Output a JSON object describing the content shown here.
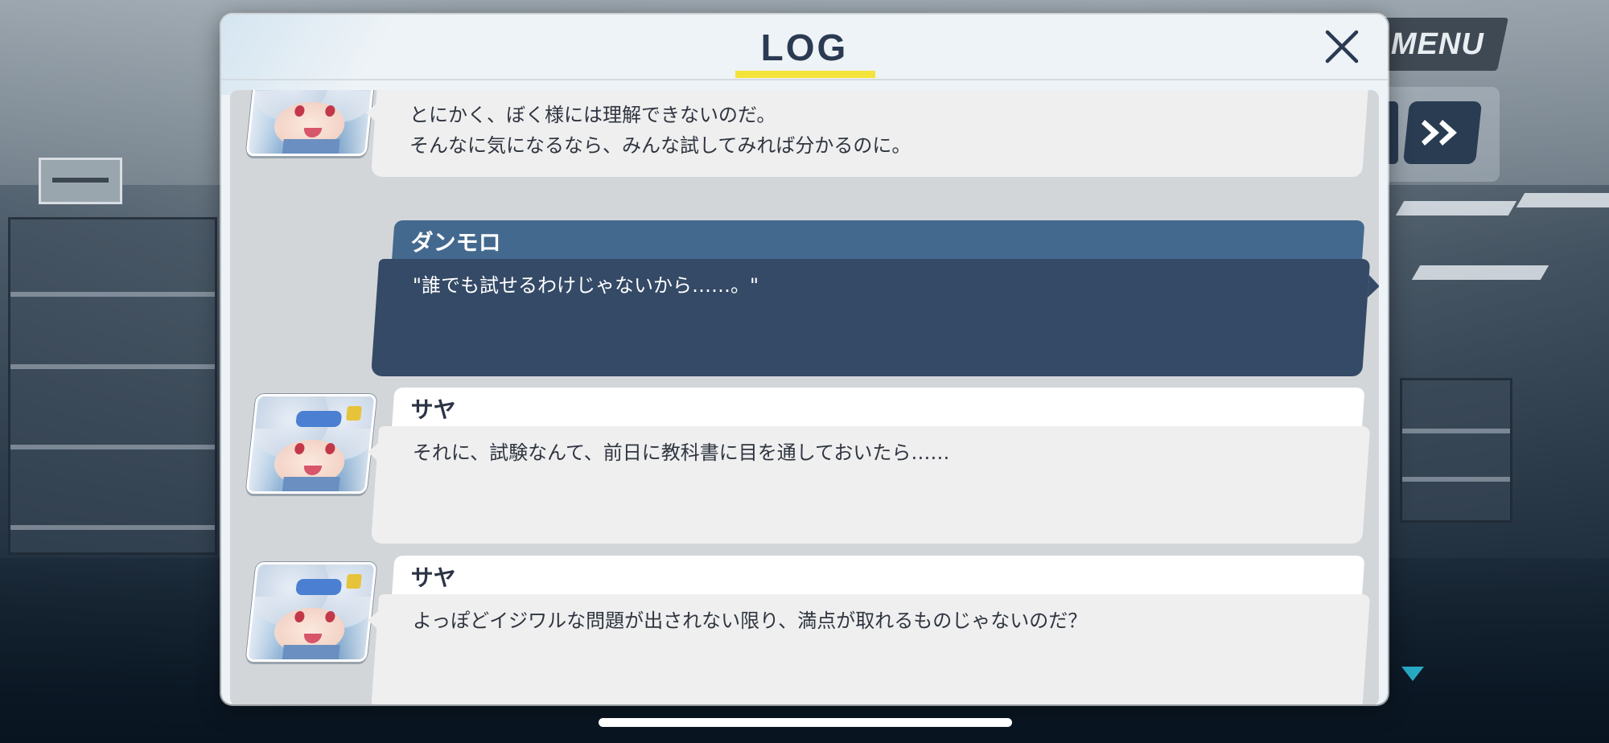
{
  "hud": {
    "menu_label": "MENU",
    "fast_forward_icon": "fast-forward-icon",
    "scroll_down_icon": "triangle-down-icon"
  },
  "log": {
    "title": "LOG",
    "close_icon": "close-icon",
    "accent_color": "#f4e33a",
    "entries": [
      {
        "speaker": "",
        "has_avatar": true,
        "text": "とにかく、ぼく様には理解できないのだ。\nそんなに気になるなら、みんな試してみれば分かるのに。"
      },
      {
        "speaker": "ダンモロ",
        "has_avatar": false,
        "text": "\"誰でも試せるわけじゃないから……。\""
      },
      {
        "speaker": "サヤ",
        "has_avatar": true,
        "text": "それに、試験なんて、前日に教科書に目を通しておいたら……"
      },
      {
        "speaker": "サヤ",
        "has_avatar": true,
        "text": "よっぽどイジワルな問題が出されない限り、満点が取れるものじゃないのだ？"
      }
    ]
  },
  "colors": {
    "player_header": "#44698f",
    "player_body": "#344a66",
    "npc_body": "#efefef",
    "title_text": "#2a3a52"
  }
}
